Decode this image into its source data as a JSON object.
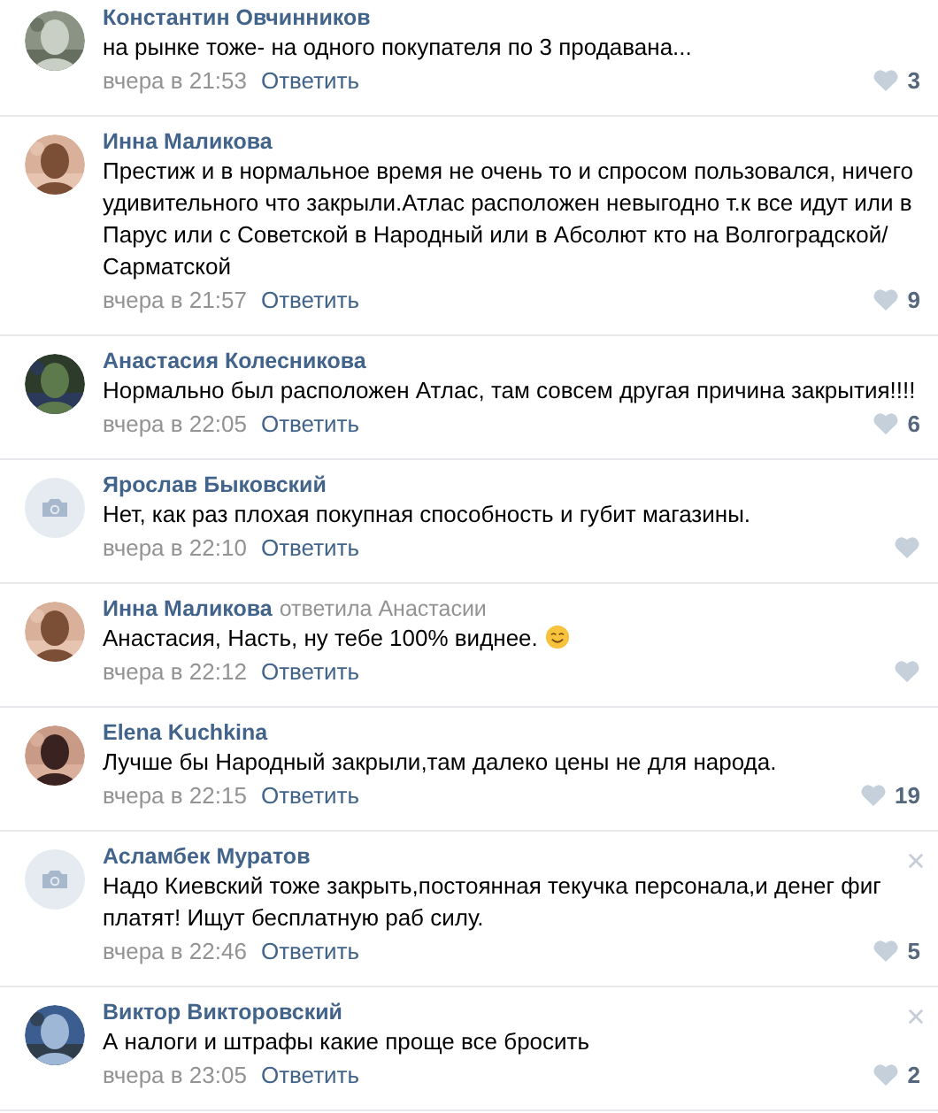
{
  "comments": [
    {
      "author": "Константин Овчинников",
      "text": "на рынке тоже- на одного покупателя по 3 продавана...",
      "time": "вчера в 21:53",
      "reply": "Ответить",
      "likes": "3",
      "closable": false
    },
    {
      "author": "Инна Маликова",
      "text": "Престиж и в нормальное время не очень то и спросом пользовался, ничего удивительного что закрыли.Атлас расположен невыгодно т.к все идут или в Парус или с Советской в Народный или в Абсолют кто на Волгоградской/ Сарматской",
      "time": "вчера в 21:57",
      "reply": "Ответить",
      "likes": "9",
      "closable": false
    },
    {
      "author": "Анастасия Колесникова",
      "text": "Нормально был расположен Атлас, там совсем другая причина закрытия!!!!",
      "time": "вчера в 22:05",
      "reply": "Ответить",
      "likes": "6",
      "closable": false
    },
    {
      "avatar": {
        "kind": "placeholder"
      },
      "author": "Ярослав Быковский",
      "text": "Нет, как раз плохая покупная способность и губит магазины.",
      "time": "вчера в 22:10",
      "reply": "Ответить",
      "closable": false
    },
    {
      "author": "Инна Маликова",
      "reply_to": "ответила Анастасии",
      "text": "Анастасия, Насть, ну тебе 100% виднее.",
      "emoji": true,
      "time": "вчера в 22:12",
      "reply": "Ответить",
      "closable": false
    },
    {
      "author": "Elena Kuchkina",
      "text": "Лучше бы Народный закрыли,там далеко цены не для народа.",
      "time": "вчера в 22:15",
      "reply": "Ответить",
      "likes": "19",
      "closable": false
    },
    {
      "avatar": {
        "kind": "placeholder"
      },
      "author": "Асламбек Муратов",
      "text": "Надо Киевский тоже закрыть,постоянная текучка персонала,и денег фиг платят! Ищут бесплатную раб силу.",
      "time": "вчера в 22:46",
      "reply": "Ответить",
      "likes": "5",
      "closable": true
    },
    {
      "author": "Виктор Викторовский",
      "text": "А налоги и штрафы какие проще все бросить",
      "time": "вчера в 23:05",
      "reply": "Ответить",
      "likes": "2",
      "closable": true
    }
  ]
}
